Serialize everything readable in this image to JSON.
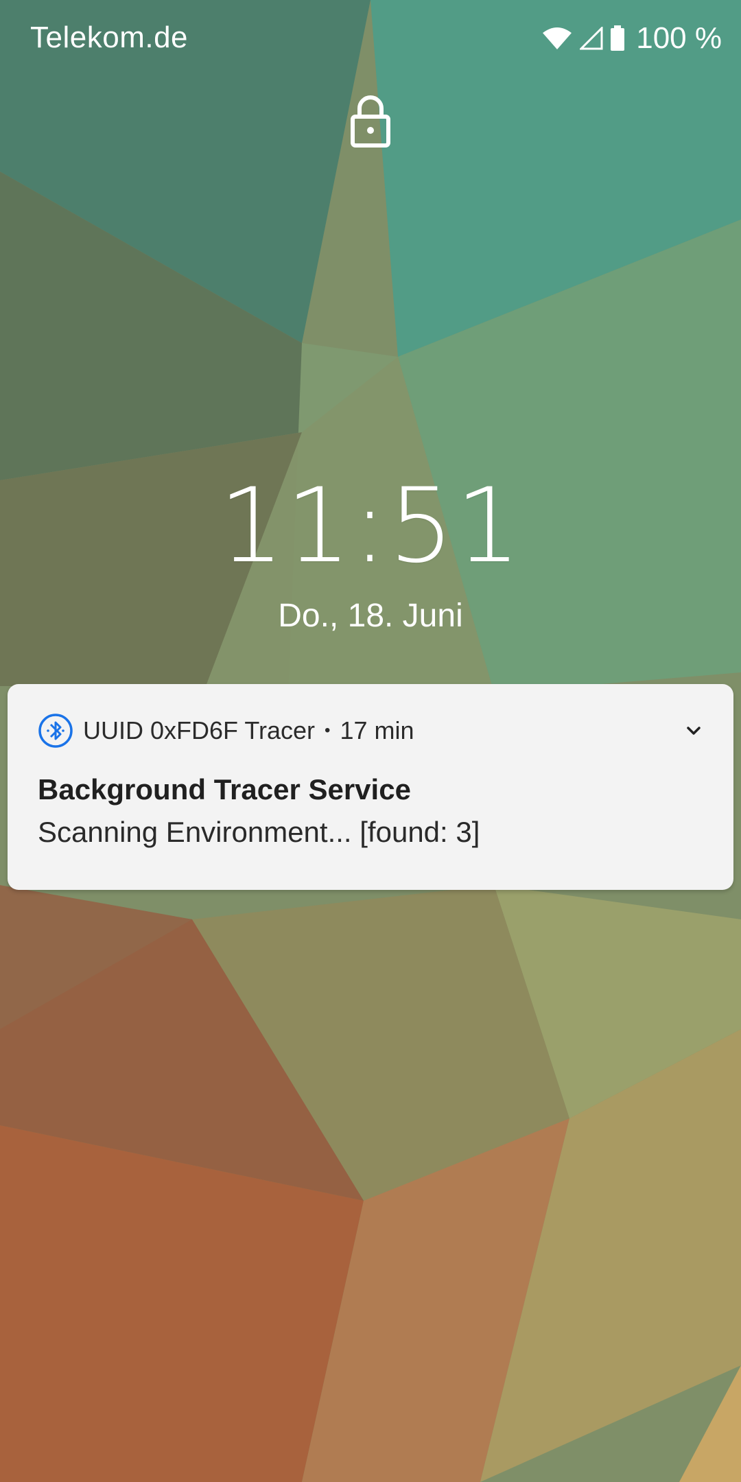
{
  "status_bar": {
    "carrier": "Telekom.de",
    "battery_percent": "100 %",
    "icons": [
      "wifi-icon",
      "cell-signal-icon",
      "battery-icon"
    ]
  },
  "lock_screen": {
    "lock_icon": "lock-icon",
    "time": "11:51",
    "date": "Do., 18. Juni"
  },
  "notification": {
    "app_icon": "bluetooth-icon",
    "app_name": "UUID 0xFD6F Tracer",
    "separator": "•",
    "age": "17 min",
    "title": "Background Tracer Service",
    "text": "Scanning Environment... [found: 3]",
    "expand_icon": "chevron-down-icon",
    "accent_color": "#1a73e8"
  }
}
